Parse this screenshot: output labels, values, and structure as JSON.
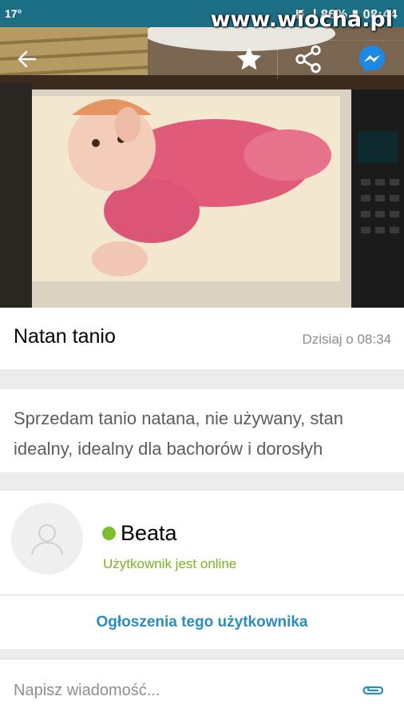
{
  "status_bar": {
    "temperature": "17°",
    "right_text": "H .l 86% ▮ 08:44",
    "watermark": "www.wiocha.pl"
  },
  "header": {
    "icons": [
      "back-arrow-icon",
      "star-icon",
      "share-icon",
      "messenger-icon"
    ]
  },
  "listing": {
    "title": "Natan tanio",
    "date": "Dzisiaj o 08:34",
    "description": "Sprzedam tanio natana, nie używany, stan idealny, idealny dla bachorów i dorosłyh"
  },
  "seller": {
    "name": "Beata",
    "status": "Użytkownik jest online",
    "ads_link": "Ogłoszenia tego użytkownika"
  },
  "message": {
    "placeholder": "Napisz wiadomość..."
  },
  "colors": {
    "status_bar": "#1d6f86",
    "online_green": "#7bb31f",
    "link_blue": "#2a8cc0",
    "messenger_blue": "#1e88e5"
  }
}
